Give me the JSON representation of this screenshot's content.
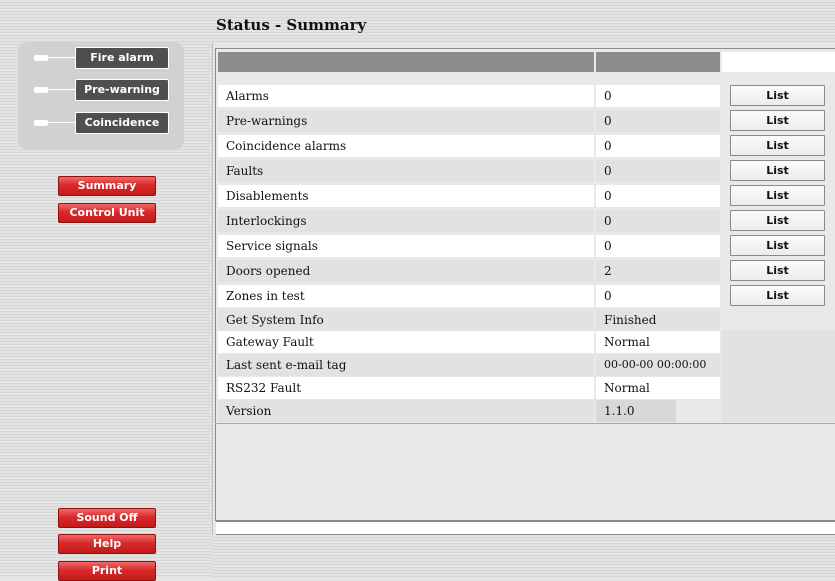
{
  "title": "Status - Summary",
  "indicators": [
    {
      "label": "Fire alarm"
    },
    {
      "label": "Pre-warning"
    },
    {
      "label": "Coincidence"
    }
  ],
  "nav": {
    "summary": "Summary",
    "control_unit": "Control Unit",
    "sound_off": "Sound Off",
    "help": "Help",
    "print": "Print"
  },
  "list_label": "List",
  "rows": [
    {
      "label": "Alarms",
      "value": "0"
    },
    {
      "label": "Pre-warnings",
      "value": "0"
    },
    {
      "label": "Coincidence alarms",
      "value": "0"
    },
    {
      "label": "Faults",
      "value": "0"
    },
    {
      "label": "Disablements",
      "value": "0"
    },
    {
      "label": "Interlockings",
      "value": "0"
    },
    {
      "label": "Service signals",
      "value": "0"
    },
    {
      "label": "Doors opened",
      "value": "2"
    },
    {
      "label": "Zones in test",
      "value": "0"
    },
    {
      "label": "Get System Info",
      "value": "Finished"
    },
    {
      "label": "Gateway Fault",
      "value": "Normal"
    },
    {
      "label": "Last sent e-mail tag",
      "value": "00-00-00 00:00:00"
    },
    {
      "label": "RS232 Fault",
      "value": "Normal"
    },
    {
      "label": "Version",
      "value": "1.1.0"
    }
  ]
}
